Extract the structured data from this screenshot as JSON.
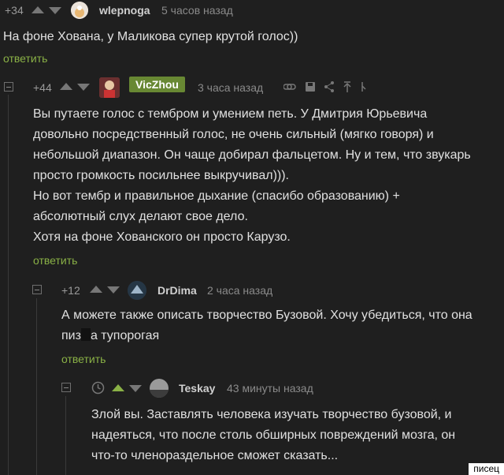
{
  "comments": [
    {
      "rating": "+34",
      "author": "wlepnoga",
      "time": "5 часов назад",
      "text": "На фоне Хована, у Маликова супер крутой голос))",
      "reply_label": "ответить"
    },
    {
      "rating": "+44",
      "author": "VicZhou",
      "time": "3 часа назад",
      "lines": [
        "Вы путаете голос с тембром и умением петь. У Дмитрия Юрьевича",
        "довольно посредственный голос, не очень сильный (мягко говоря) и",
        "небольшой диапазон. Он чаще добирал фальцетом. Ну и тем, что звукарь",
        "просто громкость посильнее выкручивал))).",
        "Но вот тембр и правильное дыхание (спасибо образованию) +",
        "абсолютный слух делают свое дело.",
        "Хотя на фоне Хованского он просто Карузо."
      ],
      "reply_label": "ответить"
    },
    {
      "rating": "+12",
      "author": "DrDima",
      "time": "2 часа назад",
      "line1": "А можете также описать творчество Бузовой. Хочу убедиться, что она",
      "line2_pre": "пиз",
      "line2_post": "а тупорогая",
      "reply_label": "ответить"
    },
    {
      "author": "Teskay",
      "time": "43 минуты назад",
      "lines": [
        "Злой вы. Заставлять человека изучать творчество бузовой, и",
        "надеяться, что после столь обширных повреждений мозга, он",
        "что-то членораздельное сможет сказать..."
      ]
    }
  ],
  "watermark": "писец",
  "colors": {
    "background": "#1f1f1f",
    "accent": "#8ab146",
    "author_badge": "#688833"
  }
}
